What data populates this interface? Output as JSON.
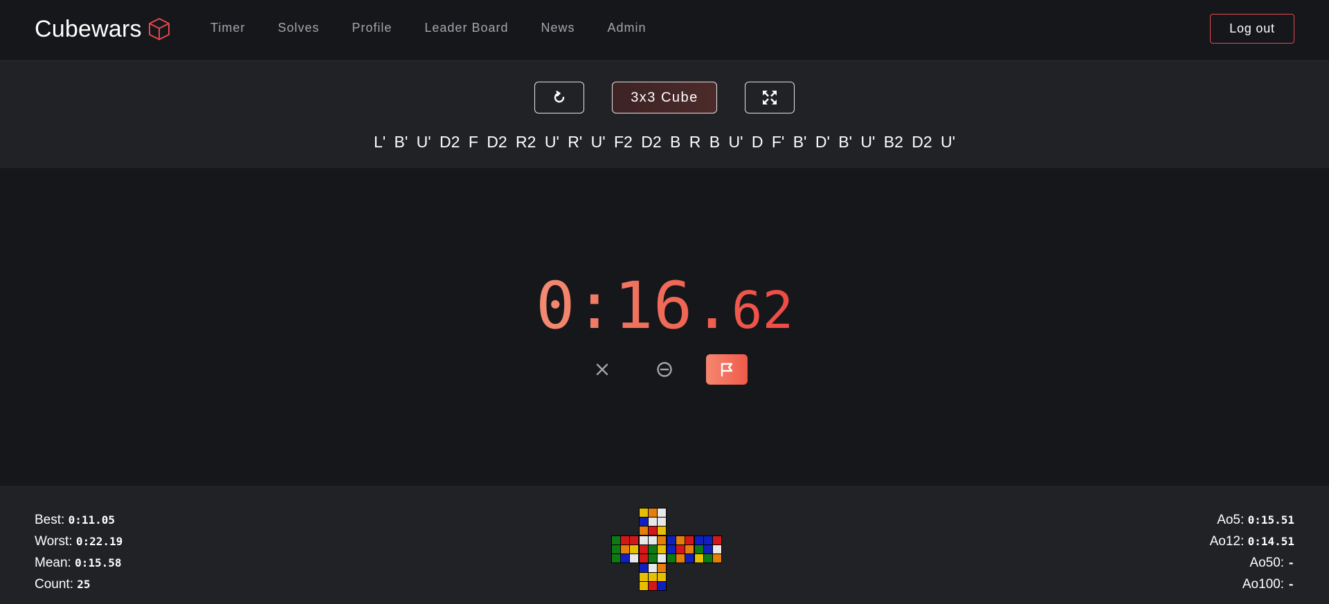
{
  "app": {
    "brand": "Cubewars",
    "logo_icon": "cube-icon",
    "accent_color": "#e3484b"
  },
  "nav": {
    "items": [
      {
        "label": "Timer"
      },
      {
        "label": "Solves"
      },
      {
        "label": "Profile"
      },
      {
        "label": "Leader Board"
      },
      {
        "label": "News"
      },
      {
        "label": "Admin"
      }
    ],
    "logout_label": "Log out"
  },
  "toolbar": {
    "reset_icon": "refresh-icon",
    "puzzle_label": "3x3 Cube",
    "fullscreen_icon": "fullscreen-icon"
  },
  "scramble": "L' B' U' D2 F D2 R2 U' R' U' F2 D2 B R B U' D F' B' D' B' U' B2 D2 U'",
  "timer": {
    "main": "0:16.",
    "ms": "62",
    "delete_icon": "close-icon",
    "dnf_icon": "minus-circle-icon",
    "plus2_icon": "flag-icon"
  },
  "stats": {
    "best_label": "Best:",
    "best_value": "0:11.05",
    "worst_label": "Worst:",
    "worst_value": "0:22.19",
    "mean_label": "Mean:",
    "mean_value": "0:15.58",
    "count_label": "Count:",
    "count_value": "25",
    "ao5_label": "Ao5:",
    "ao5_value": "0:15.51",
    "ao12_label": "Ao12:",
    "ao12_value": "0:14.51",
    "ao50_label": "Ao50:",
    "ao50_value": "-",
    "ao100_label": "Ao100:",
    "ao100_value": "-"
  },
  "cube_colors": {
    "W": "#e8e8e8",
    "Y": "#e6c000",
    "R": "#d41818",
    "O": "#e67e0a",
    "G": "#0e7a14",
    "B": "#1020c0"
  },
  "cube_state": {
    "U": [
      "Y",
      "O",
      "W",
      "B",
      "W",
      "W",
      "O",
      "R",
      "Y"
    ],
    "L": [
      "G",
      "R",
      "R",
      "G",
      "O",
      "Y",
      "G",
      "B",
      "W"
    ],
    "F": [
      "W",
      "W",
      "O",
      "R",
      "G",
      "Y",
      "R",
      "G",
      "W"
    ],
    "R": [
      "B",
      "O",
      "R",
      "B",
      "R",
      "O",
      "G",
      "O",
      "B"
    ],
    "B": [
      "B",
      "B",
      "R",
      "G",
      "B",
      "W",
      "Y",
      "G",
      "O"
    ],
    "D": [
      "B",
      "W",
      "O",
      "Y",
      "Y",
      "Y",
      "Y",
      "R",
      "B"
    ]
  }
}
